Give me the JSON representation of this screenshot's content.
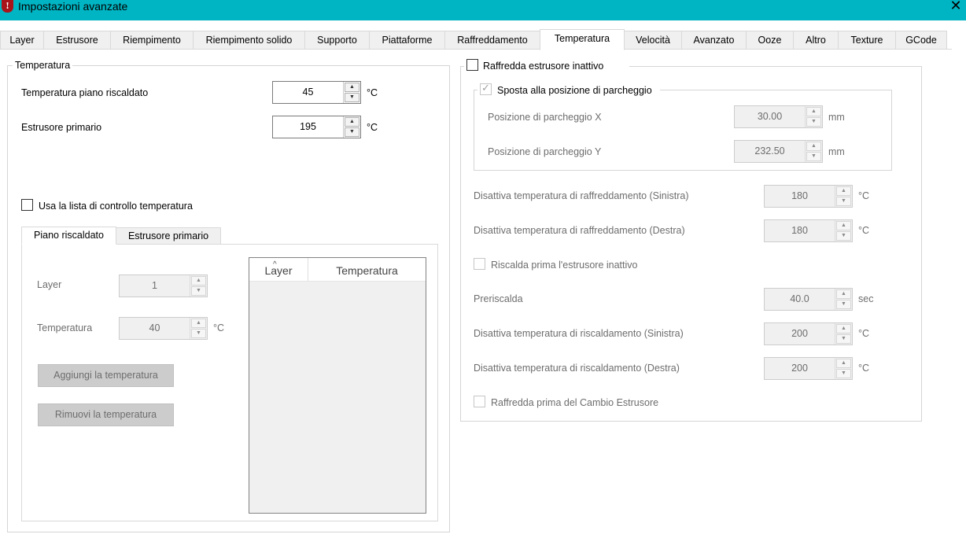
{
  "window": {
    "title": "Impostazioni avanzate",
    "icon_glyph": "!"
  },
  "tabs": [
    {
      "label": "Layer"
    },
    {
      "label": "Estrusore"
    },
    {
      "label": "Riempimento"
    },
    {
      "label": "Riempimento solido"
    },
    {
      "label": "Supporto"
    },
    {
      "label": "Piattaforme"
    },
    {
      "label": "Raffreddamento"
    },
    {
      "label": "Temperatura"
    },
    {
      "label": "Velocità"
    },
    {
      "label": "Avanzato"
    },
    {
      "label": "Ooze"
    },
    {
      "label": "Altro"
    },
    {
      "label": "Texture"
    },
    {
      "label": "GCode"
    }
  ],
  "active_tab": "Temperatura",
  "temperature_group": {
    "title": "Temperatura",
    "bed": {
      "label": "Temperatura piano riscaldato",
      "value": "45",
      "unit": "°C"
    },
    "primary_extruder": {
      "label": "Estrusore primario",
      "value": "195",
      "unit": "°C"
    },
    "use_control_list": {
      "label": "Usa la lista di controllo temperatura",
      "checked": false
    },
    "inner_tabs": [
      {
        "label": "Piano riscaldato"
      },
      {
        "label": "Estrusore primario"
      }
    ],
    "layer": {
      "label": "Layer",
      "value": "1"
    },
    "temperature": {
      "label": "Temperatura",
      "value": "40",
      "unit": "°C"
    },
    "add_button": "Aggiungi la temperatura",
    "remove_button": "Rimuovi la temperatura",
    "list": {
      "columns": [
        "Layer",
        "Temperatura"
      ],
      "sort_glyph": "^"
    }
  },
  "cool_idle_group": {
    "title": "Raffredda estrusore inattivo",
    "checked": false,
    "park_group": {
      "title": "Sposta alla posizione di parcheggio",
      "checked": true,
      "check_glyph": "✓",
      "park_x": {
        "label": "Posizione di parcheggio X",
        "value": "30.00",
        "unit": "mm"
      },
      "park_y": {
        "label": "Posizione di parcheggio Y",
        "value": "232.50",
        "unit": "mm"
      }
    },
    "cool_off_left": {
      "label": "Disattiva temperatura di raffreddamento (Sinistra)",
      "value": "180",
      "unit": "°C"
    },
    "cool_off_right": {
      "label": "Disattiva temperatura di raffreddamento (Destra)",
      "value": "180",
      "unit": "°C"
    },
    "preheat_idle": {
      "label": "Riscalda prima l'estrusore inattivo",
      "checked": false
    },
    "preheat": {
      "label": "Preriscalda",
      "value": "40.0",
      "unit": "sec"
    },
    "heat_off_left": {
      "label": "Disattiva temperatura di riscaldamento (Sinistra)",
      "value": "200",
      "unit": "°C"
    },
    "heat_off_right": {
      "label": "Disattiva temperatura di riscaldamento (Destra)",
      "value": "200",
      "unit": "°C"
    },
    "cool_before_change": {
      "label": "Raffredda prima del Cambio Estrusore",
      "checked": false
    }
  },
  "icons": {
    "up": "▲",
    "down": "▼",
    "close": "✕"
  },
  "colors": {
    "titlebar": "#00b5c3",
    "disabled_text": "#6d6d6d"
  }
}
